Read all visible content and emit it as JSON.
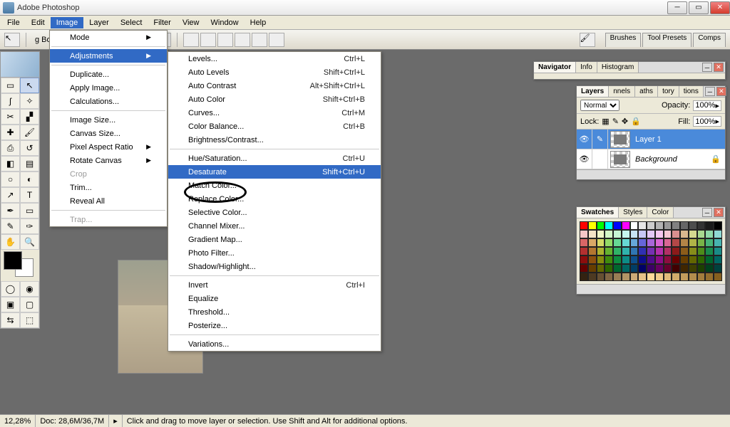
{
  "window": {
    "title": "Adobe Photoshop"
  },
  "menubar": [
    "File",
    "Edit",
    "Image",
    "Layer",
    "Select",
    "Filter",
    "View",
    "Window",
    "Help"
  ],
  "menubar_open_index": 2,
  "optionbar": {
    "box_label": "g Box",
    "right_tabs": [
      "Brushes",
      "Tool Presets",
      "Comps"
    ]
  },
  "image_menu": [
    {
      "label": "Mode",
      "arrow": true
    },
    {
      "sep": true
    },
    {
      "label": "Adjustments",
      "arrow": true,
      "hl": true
    },
    {
      "sep": true
    },
    {
      "label": "Duplicate..."
    },
    {
      "label": "Apply Image..."
    },
    {
      "label": "Calculations..."
    },
    {
      "sep": true
    },
    {
      "label": "Image Size..."
    },
    {
      "label": "Canvas Size..."
    },
    {
      "label": "Pixel Aspect Ratio",
      "arrow": true
    },
    {
      "label": "Rotate Canvas",
      "arrow": true
    },
    {
      "label": "Crop",
      "disabled": true
    },
    {
      "label": "Trim..."
    },
    {
      "label": "Reveal All"
    },
    {
      "sep": true
    },
    {
      "label": "Trap...",
      "disabled": true
    }
  ],
  "adjustments_menu": [
    {
      "label": "Levels...",
      "shortcut": "Ctrl+L"
    },
    {
      "label": "Auto Levels",
      "shortcut": "Shift+Ctrl+L"
    },
    {
      "label": "Auto Contrast",
      "shortcut": "Alt+Shift+Ctrl+L"
    },
    {
      "label": "Auto Color",
      "shortcut": "Shift+Ctrl+B"
    },
    {
      "label": "Curves...",
      "shortcut": "Ctrl+M"
    },
    {
      "label": "Color Balance...",
      "shortcut": "Ctrl+B"
    },
    {
      "label": "Brightness/Contrast..."
    },
    {
      "sep": true
    },
    {
      "label": "Hue/Saturation...",
      "shortcut": "Ctrl+U"
    },
    {
      "label": "Desaturate",
      "shortcut": "Shift+Ctrl+U",
      "hl": true
    },
    {
      "label": "Match Color..."
    },
    {
      "label": "Replace Color..."
    },
    {
      "label": "Selective Color..."
    },
    {
      "label": "Channel Mixer..."
    },
    {
      "label": "Gradient Map..."
    },
    {
      "label": "Photo Filter..."
    },
    {
      "label": "Shadow/Highlight..."
    },
    {
      "sep": true
    },
    {
      "label": "Invert",
      "shortcut": "Ctrl+I"
    },
    {
      "label": "Equalize"
    },
    {
      "label": "Threshold..."
    },
    {
      "label": "Posterize..."
    },
    {
      "sep": true
    },
    {
      "label": "Variations..."
    }
  ],
  "navigator_panel": {
    "tabs": [
      "Navigator",
      "Info",
      "Histogram"
    ]
  },
  "layers_panel": {
    "tabs": [
      "Layers",
      "nnels",
      "aths",
      "tory",
      "tions"
    ],
    "blend_mode": "Normal",
    "opacity_label": "Opacity:",
    "opacity_value": "100%",
    "lock_label": "Lock:",
    "fill_label": "Fill:",
    "fill_value": "100%",
    "layers": [
      {
        "name": "Layer 1",
        "selected": true
      },
      {
        "name": "Background",
        "italic": true
      }
    ]
  },
  "swatches_panel": {
    "tabs": [
      "Swatches",
      "Styles",
      "Color"
    ]
  },
  "swatch_colors": [
    [
      "#ff0000",
      "#ffff00",
      "#00ff00",
      "#00ffff",
      "#0000ff",
      "#ff00ff",
      "#ffffff",
      "#e6e6e6",
      "#cccccc",
      "#b3b3b3",
      "#999999",
      "#808080",
      "#666666",
      "#4d4d4d",
      "#333333",
      "#1a1a1a",
      "#000000"
    ],
    [
      "#f5c7c7",
      "#f5e3c7",
      "#f0f5c7",
      "#d4f5c7",
      "#c7f5d4",
      "#c7f5f0",
      "#c7e3f5",
      "#c7c7f5",
      "#e3c7f5",
      "#f5c7f0",
      "#f5c7d4",
      "#d98f8f",
      "#d9b88f",
      "#d4d98f",
      "#a8d98f",
      "#8fd9a8",
      "#8fd9d4"
    ],
    [
      "#d96666",
      "#d9a866",
      "#d4d966",
      "#94d966",
      "#66d994",
      "#66d9d4",
      "#66a8d9",
      "#6666d9",
      "#a866d9",
      "#d966d4",
      "#d96694",
      "#b34747",
      "#b38547",
      "#b0b347",
      "#78b347",
      "#47b378",
      "#47b3b0"
    ],
    [
      "#b33030",
      "#b37630",
      "#adb330",
      "#66b330",
      "#30b366",
      "#30b3ad",
      "#3076b3",
      "#3030b3",
      "#7630b3",
      "#b330ad",
      "#b33066",
      "#8c1a1a",
      "#8c5c1a",
      "#878c1a",
      "#4d8c1a",
      "#1a8c4d",
      "#1a8c87"
    ],
    [
      "#8c0d0d",
      "#8c4f0d",
      "#878c0d",
      "#3f8c0d",
      "#0d8c3f",
      "#0d8c87",
      "#0d4f8c",
      "#0d0d8c",
      "#4f0d8c",
      "#8c0d87",
      "#8c0d3f",
      "#660000",
      "#663d00",
      "#636600",
      "#2e6600",
      "#00662e",
      "#006663"
    ],
    [
      "#660000",
      "#663d00",
      "#636600",
      "#2e6600",
      "#00662e",
      "#006663",
      "#003d66",
      "#000066",
      "#3d0066",
      "#660063",
      "#66002e",
      "#400000",
      "#402600",
      "#3e4000",
      "#1c4000",
      "#00401c",
      "#00403e"
    ],
    [
      "#332211",
      "#4d3a22",
      "#665033",
      "#806644",
      "#997d55",
      "#b39466",
      "#ccab77",
      "#e6c288",
      "#ffd999",
      "#f0ca8a",
      "#e0ba7a",
      "#d1ab6b",
      "#c29c5c",
      "#b38d4d",
      "#a37d3d",
      "#946e2e",
      "#855f1f"
    ]
  ],
  "status": {
    "zoom": "12,28%",
    "doc": "Doc: 28,6M/36,7M",
    "hint": "Click and drag to move layer or selection.  Use Shift and Alt for additional options."
  }
}
